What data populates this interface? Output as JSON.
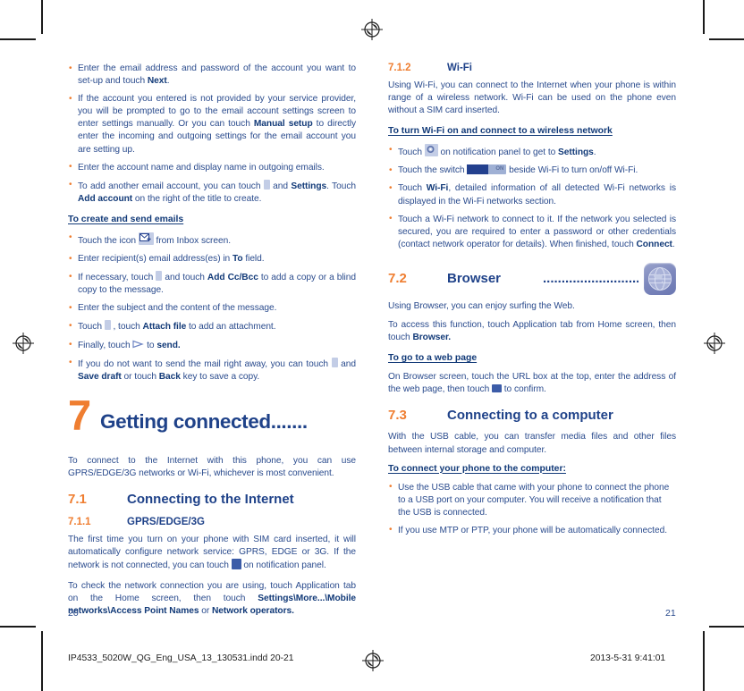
{
  "document": {
    "left_page_number": "20",
    "right_page_number": "21",
    "footer_filename": "IP4533_5020W_QG_Eng_USA_13_130531.indd   20-21",
    "footer_datetime": "2013-5-31   9:41:01"
  },
  "colors": {
    "body_text": "#2a4b8d",
    "heading_blue": "#1f4289",
    "accent_orange": "#ef7e31",
    "bullet_orange": "#ef7e31",
    "icon_chip_bg": "#c3cde6",
    "switch_on": "#23408e"
  },
  "left_column": {
    "bullets_email_setup": [
      "Enter the email address and password of the account you want to set-up and touch <b>Next</b>.",
      "If the account you entered is not provided by your service provider, you will be prompted to go to the email account settings screen to enter settings manually. Or you can touch <b>Manual setup</b> to directly enter the incoming and outgoing settings for the email account you are setting up.",
      "Enter the account name and display name in outgoing emails.",
      "To add another email account, you can touch <span class=\"mini mini-dots\" data-name=\"overflow-menu-icon\" data-interactable=\"false\"></span> and <b>Settings</b>. Touch <b>Add account</b> on the right of the title to create."
    ],
    "subhead_create_send": "To create and send emails",
    "bullets_create_send": [
      "Touch the icon <span class=\"mini mini-env\" data-name=\"compose-email-icon\" data-interactable=\"false\"><svg width=\"13\" height=\"10\" viewBox=\"0 0 13 10\"><rect x=\"0.5\" y=\"0.5\" width=\"10\" height=\"8\" fill=\"#ffffff\" stroke=\"#23408e\"/><path d=\"M0.5 0.5 L5.5 5 L10.5 0.5\" fill=\"none\" stroke=\"#23408e\"/><path d=\"M8.5 6.5 h4 M10.5 4.5 v4\" stroke=\"#23408e\" stroke-width=\"1.4\"/></svg></span> from Inbox screen.",
      "Enter recipient(s) email address(es) in <b>To</b> field.",
      "If necessary, touch <span class=\"mini mini-dots\" data-name=\"overflow-menu-icon\" data-interactable=\"false\"></span> and touch <b>Add Cc/Bcc</b> to add a copy or a blind copy to the message.",
      "Enter the subject and the content of the message.",
      "Touch <span class=\"mini mini-dots\" data-name=\"overflow-menu-icon\" data-interactable=\"false\"></span> , touch <b>Attach file</b> to add an attachment.",
      "Finally, touch <span class=\"mini mini-send\" data-name=\"send-icon\" data-interactable=\"false\"><svg width=\"13\" height=\"10\" viewBox=\"0 0 13 10\"><path d=\"M1 1.5 L11 5 L1 8.5 Z\" fill=\"none\" stroke=\"#6f86c4\" stroke-width=\"1.2\"/></svg></span> to <b>send.</b>",
      "If you do not want to send the mail right away, you can touch <span class=\"mini mini-dots\" data-name=\"overflow-menu-icon\" data-interactable=\"false\"></span> and <b>Save draft</b> or touch <b>Back</b> key to save a copy."
    ],
    "chapter": {
      "number": "7",
      "title": "Getting connected......."
    },
    "chapter_intro": "To connect to the Internet with this phone, you can use GPRS/EDGE/3G networks or Wi-Fi, whichever is most convenient.",
    "section_71": {
      "number": "7.1",
      "title": "Connecting to the Internet"
    },
    "section_711": {
      "number": "7.1.1",
      "title": "GPRS/EDGE/3G"
    },
    "para_711_a": "The first time you turn on your phone with SIM card inserted, it will automatically configure network service: GPRS, EDGE or 3G. If the network is not connected, you can touch <span class=\"mini mini-sig\" data-name=\"signal-icon\" data-interactable=\"false\"></span> on notification panel.",
    "para_711_b": "To check the network connection you are using, touch Application tab on the Home screen, then touch <b>Settings\\More...\\Mobile networks\\Access Point Names</b> or <b>Network operators.</b>"
  },
  "right_column": {
    "section_712": {
      "number": "7.1.2",
      "title": "Wi-Fi"
    },
    "para_712": "Using Wi-Fi, you can connect to the Internet when your phone is within range of a wireless network. Wi-Fi can be used on the phone even without a SIM card inserted.",
    "subhead_turn_on": "To turn Wi-Fi on and connect to a wireless network",
    "bullets_wifi": [
      "Touch <span class=\"mini mini-gear\" data-name=\"settings-gear-icon\" data-interactable=\"false\"><svg width=\"11\" height=\"10\" viewBox=\"0 0 11 10\"><circle cx=\"5.5\" cy=\"5\" r=\"3.2\" fill=\"none\" stroke=\"#5d72ab\" stroke-width=\"1.6\"/><circle cx=\"5.5\" cy=\"5\" r=\"1.1\" fill=\"#ffffff\"/></svg></span> on notification panel to get to <b>Settings</b>.",
      "Touch the switch <span class=\"switch\" data-name=\"wifi-toggle-switch\" data-interactable=\"false\"><span class=\"knob\"></span><span class=\"on-lbl\">ON</span></span> beside Wi-Fi to turn on/off Wi-Fi.",
      "Touch <b>Wi-Fi</b>, detailed information of all detected Wi-Fi networks is displayed in the Wi-Fi networks section.",
      "Touch a Wi-Fi network to connect to it. If the network you selected is secured, you are required to enter a password or other credentials (contact network operator for details). When finished, touch <b>Connect</b>."
    ],
    "section_72": {
      "number": "7.2",
      "title": "Browser",
      "dots": "........................................"
    },
    "para_72_a": "Using Browser, you can enjoy surfing the Web.",
    "para_72_b": "To access this function, touch Application tab from Home screen, then touch <b>Browser.</b>",
    "subhead_web_page": "To go to a web page",
    "para_web_page": "On Browser screen, touch the URL box at the top, enter the address of the web page, then touch <span class=\"mini mini-go\" data-name=\"go-button-icon\" data-interactable=\"false\"></span> to confirm.",
    "section_73": {
      "number": "7.3",
      "title": "Connecting to a computer"
    },
    "para_73": "With the USB cable, you can transfer media files and other files between internal storage and computer.",
    "subhead_connect_pc": "To connect your phone to the computer:",
    "bullets_connect_pc": [
      "Use the USB cable that came with your phone to connect the phone to a USB port on your computer. You will receive a notification that the USB is connected.",
      "If you use MTP or PTP, your phone will be automatically connected."
    ]
  }
}
